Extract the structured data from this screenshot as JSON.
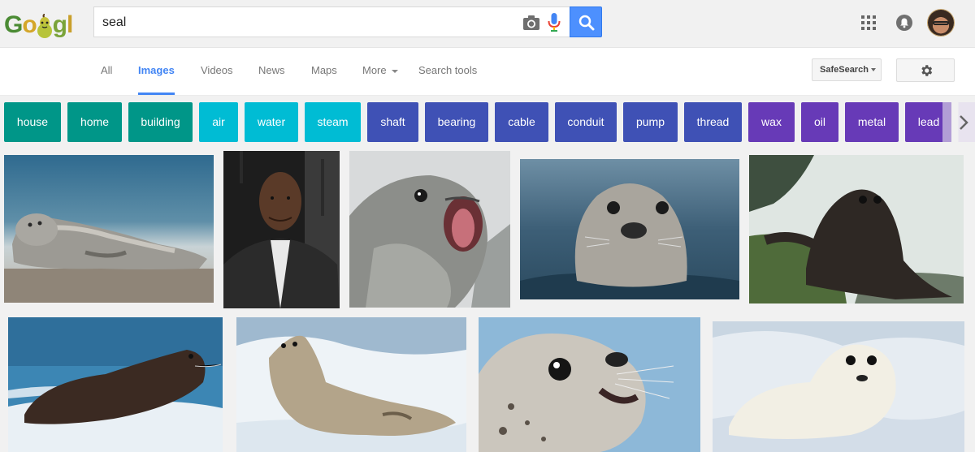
{
  "search": {
    "query": "seal"
  },
  "nav": {
    "tabs": [
      {
        "label": "All"
      },
      {
        "label": "Images"
      },
      {
        "label": "Videos"
      },
      {
        "label": "News"
      },
      {
        "label": "Maps"
      },
      {
        "label": "More"
      },
      {
        "label": "Search tools"
      }
    ],
    "active_tab": "Images",
    "safesearch_label": "SafeSearch"
  },
  "chips": [
    {
      "label": "house",
      "color": "#009688"
    },
    {
      "label": "home",
      "color": "#009688"
    },
    {
      "label": "building",
      "color": "#009688"
    },
    {
      "label": "air",
      "color": "#00bcd4"
    },
    {
      "label": "water",
      "color": "#00bcd4"
    },
    {
      "label": "steam",
      "color": "#00bcd4"
    },
    {
      "label": "shaft",
      "color": "#3f51b5"
    },
    {
      "label": "bearing",
      "color": "#3f51b5"
    },
    {
      "label": "cable",
      "color": "#3f51b5"
    },
    {
      "label": "conduit",
      "color": "#3f51b5"
    },
    {
      "label": "pump",
      "color": "#3f51b5"
    },
    {
      "label": "thread",
      "color": "#3f51b5"
    },
    {
      "label": "wax",
      "color": "#673ab7"
    },
    {
      "label": "oil",
      "color": "#673ab7"
    },
    {
      "label": "metal",
      "color": "#673ab7"
    },
    {
      "label": "lead",
      "color": "#673ab7"
    }
  ],
  "images": [
    {
      "subject": "harbor seal lying on beach"
    },
    {
      "subject": "man in black jacket"
    },
    {
      "subject": "seal pup with mouth open"
    },
    {
      "subject": "seal head in water"
    },
    {
      "subject": "dark seal on mossy rock"
    },
    {
      "subject": "dark seal on ice"
    },
    {
      "subject": "harp seal on snow"
    },
    {
      "subject": "spotted seal close-up"
    },
    {
      "subject": "white seal pup on snow"
    }
  ],
  "colors": {
    "accent": "#4285f4",
    "search_button": "#4d90fe"
  }
}
